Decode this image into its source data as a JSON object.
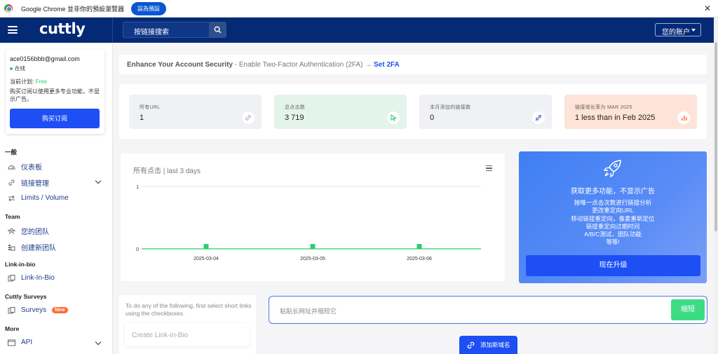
{
  "chrome_bar": {
    "message": "Google Chrome 並非你的預設瀏覽器",
    "set_default": "設為預設",
    "close": "✕"
  },
  "navbar": {
    "brand": "cuttly",
    "search_label": "按链接搜索",
    "account_label": "您的账户"
  },
  "sidebar": {
    "email": "ace0156bbb@gmail.com",
    "status": "在线",
    "plan_prefix": "当前计划: ",
    "plan_name": "Free",
    "plan_desc": "购买订阅以使用更多专业功能，不显示广告。",
    "buy_label": "购买订阅",
    "sections": {
      "general": "一般",
      "team": "Team",
      "linkinbio": "Link-in-bio",
      "surveys": "Cuttly Surveys",
      "more": "More"
    },
    "items": {
      "dashboard": "仪表板",
      "link_management": "链接管理",
      "limits": "Limits / Volume",
      "your_team": "您的团队",
      "create_team": "创建新团队",
      "link_in_bio": "Link-In-Bio",
      "surveys": "Surveys",
      "surveys_badge": "New",
      "api": "API"
    }
  },
  "security": {
    "title": "Enhance Your Account Security",
    "subtitle": " - Enable Two-Factor Authentication (2FA) → ",
    "link": "Set 2FA"
  },
  "stats": [
    {
      "title": "所有URL",
      "value": "1",
      "bg": "#f0f1f5",
      "icon": "link-icon"
    },
    {
      "title": "总点击数",
      "value": "3 719",
      "bg": "#e3f4ea",
      "icon": "cursor-icon"
    },
    {
      "title": "本月添加的链接数",
      "value": "0",
      "bg": "#f0f1f5",
      "icon": "link-off-icon"
    },
    {
      "title": "链接增长率为 MAR 2025",
      "value": "1 less than in Feb 2025",
      "bg": "#fde3d8",
      "icon": "bar-chart-icon"
    }
  ],
  "chart_heading": "所有点击 | last 3 days",
  "chart_data": {
    "type": "line",
    "categories": [
      "2025-03-04",
      "2025-03-05",
      "2025-03-06"
    ],
    "series": [
      {
        "values": [
          0,
          0,
          0
        ]
      }
    ],
    "yticks": [
      "0",
      "1"
    ],
    "ylim": [
      0,
      1
    ],
    "color": "#2ecc71"
  },
  "upgrade": {
    "title": "获取更多功能，不显示广告",
    "lines": [
      "按唯一点击次数进行链接分析",
      "更改重定向URL",
      "移动链接重定向，像素重新定位",
      "链接重定向过期时间",
      "A/B/C测试，团队功能",
      "等等!"
    ],
    "button": "现在升级"
  },
  "hint": {
    "text": "To do any of the following, first select short links using the checkboxes.",
    "create_lib": "Create Link-in-Bio"
  },
  "shorten": {
    "placeholder": "粘贴长网址并缩短它",
    "button": "缩短"
  },
  "add_domain": "添加新域名"
}
